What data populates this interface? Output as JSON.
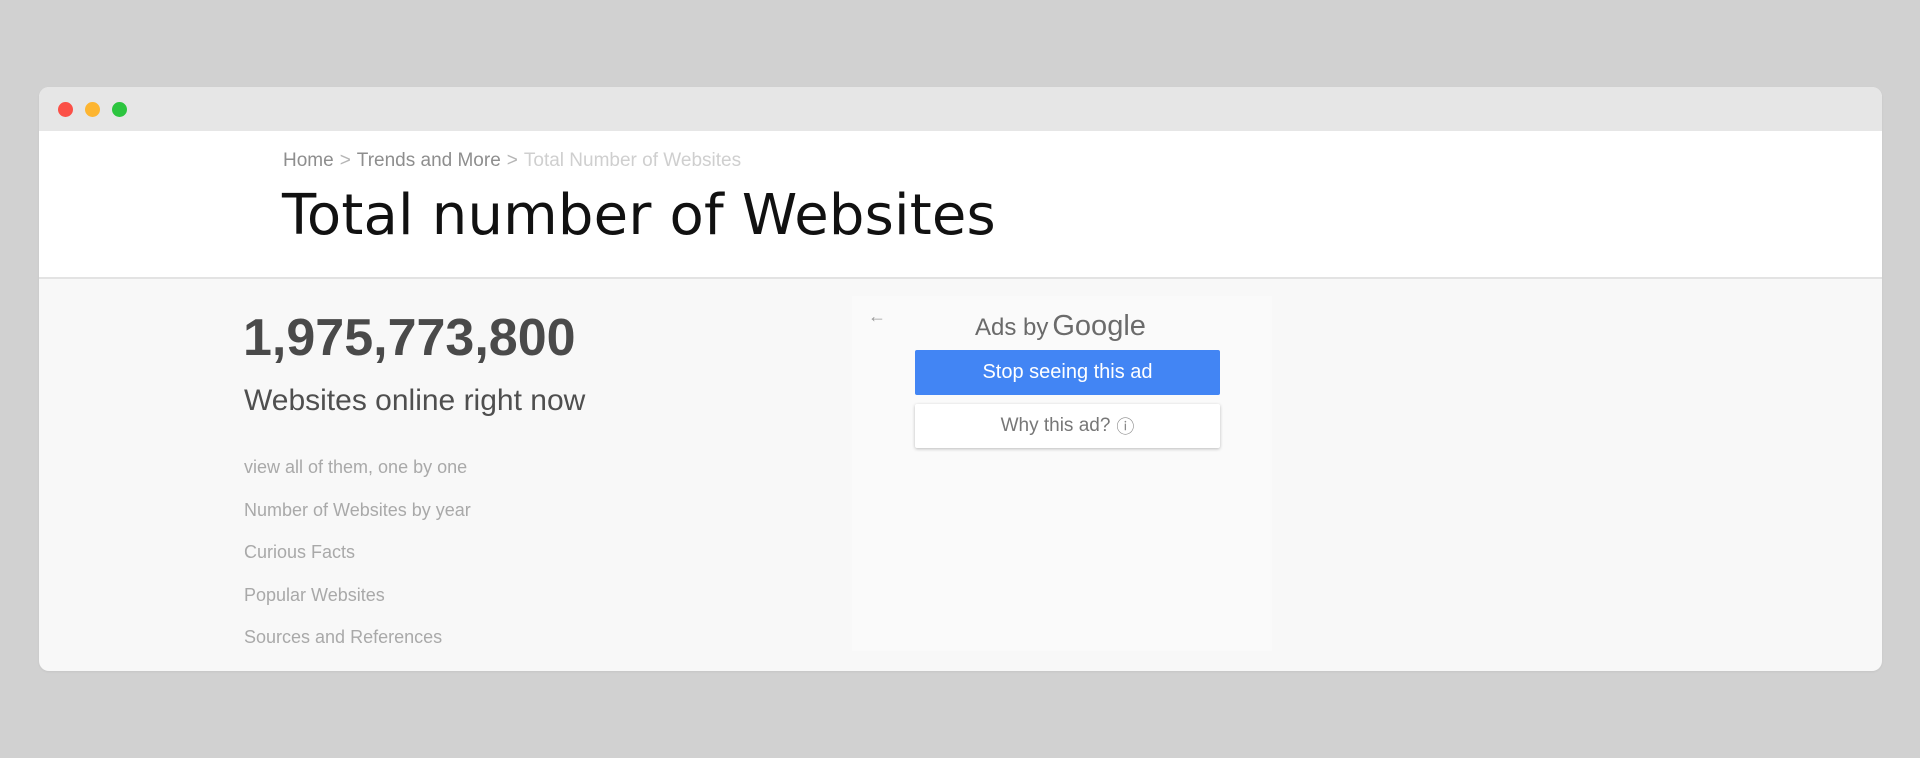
{
  "window": {
    "controls": [
      "close",
      "minimize",
      "maximize"
    ]
  },
  "breadcrumb": {
    "home": "Home",
    "separator": ">",
    "section": "Trends and More",
    "current": "Total Number of Websites"
  },
  "page": {
    "title": "Total number of Websites"
  },
  "counter": {
    "value": "1,975,773,800",
    "caption": "Websites online right now"
  },
  "links": [
    "view all of them, one by one",
    "Number of Websites by year",
    "Curious Facts",
    "Popular Websites",
    "Sources and References"
  ],
  "ad": {
    "back_icon": "←",
    "ads_by": "Ads by",
    "google": "Google",
    "stop_label": "Stop seeing this ad",
    "why_label": "Why this ad?",
    "info_icon": "ⓘ",
    "accent": "#4285f4"
  }
}
